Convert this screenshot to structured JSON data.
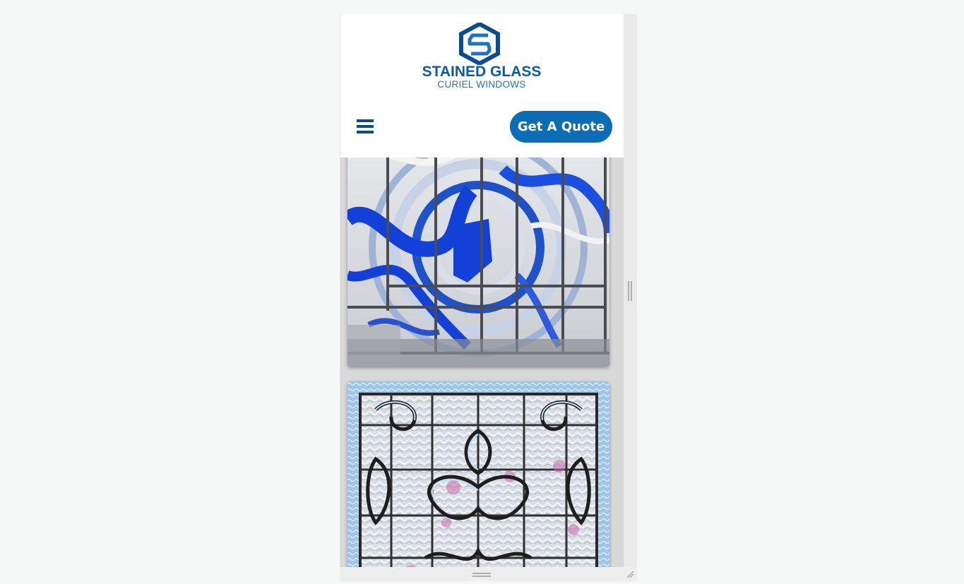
{
  "header": {
    "logo": {
      "title": "STAINED GLASS",
      "subtitle": "CURIEL WINDOWS",
      "icon": "hexagon-s-logo-icon"
    },
    "menu_icon": "hamburger-menu-icon",
    "quote_button_label": "Get A Quote"
  },
  "gallery": {
    "images": [
      {
        "subject": "blue-stained-glass-window-panel"
      },
      {
        "subject": "beveled-clear-glass-ornamental-window"
      }
    ]
  },
  "colors": {
    "brand_blue": "#0b4c8c",
    "button_blue": "#0b6db5",
    "logo_blue": "#1b73c4"
  }
}
